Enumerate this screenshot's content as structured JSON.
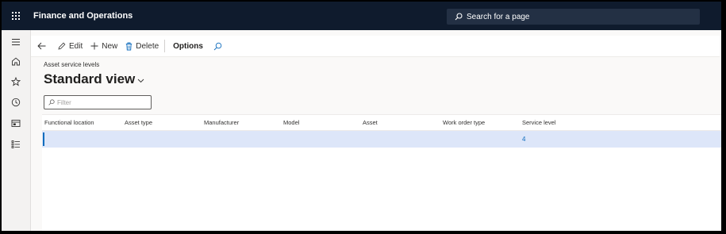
{
  "app": {
    "title": "Finance and Operations"
  },
  "search": {
    "placeholder": "Search for a page"
  },
  "nav_rail": {
    "items": [
      {
        "icon": "hamburger-menu-icon"
      },
      {
        "icon": "home-icon"
      },
      {
        "icon": "star-icon"
      },
      {
        "icon": "clock-icon"
      },
      {
        "icon": "workspace-icon"
      },
      {
        "icon": "modules-list-icon"
      }
    ]
  },
  "action_bar": {
    "edit_label": "Edit",
    "new_label": "New",
    "delete_label": "Delete",
    "options_label": "Options"
  },
  "page": {
    "caption": "Asset service levels",
    "view_name": "Standard view",
    "filter_placeholder": "Filter"
  },
  "grid": {
    "columns": [
      "Functional location",
      "Asset type",
      "Manufacturer",
      "Model",
      "Asset",
      "Work order type",
      "Service level"
    ],
    "rows": [
      {
        "functional_location": "",
        "asset_type": "",
        "manufacturer": "",
        "model": "",
        "asset": "",
        "work_order_type": "",
        "service_level": "4"
      }
    ]
  },
  "colors": {
    "top_bar": "#0f1b2d",
    "accent": "#0f6cbd",
    "selected_row": "#dde6f9"
  }
}
